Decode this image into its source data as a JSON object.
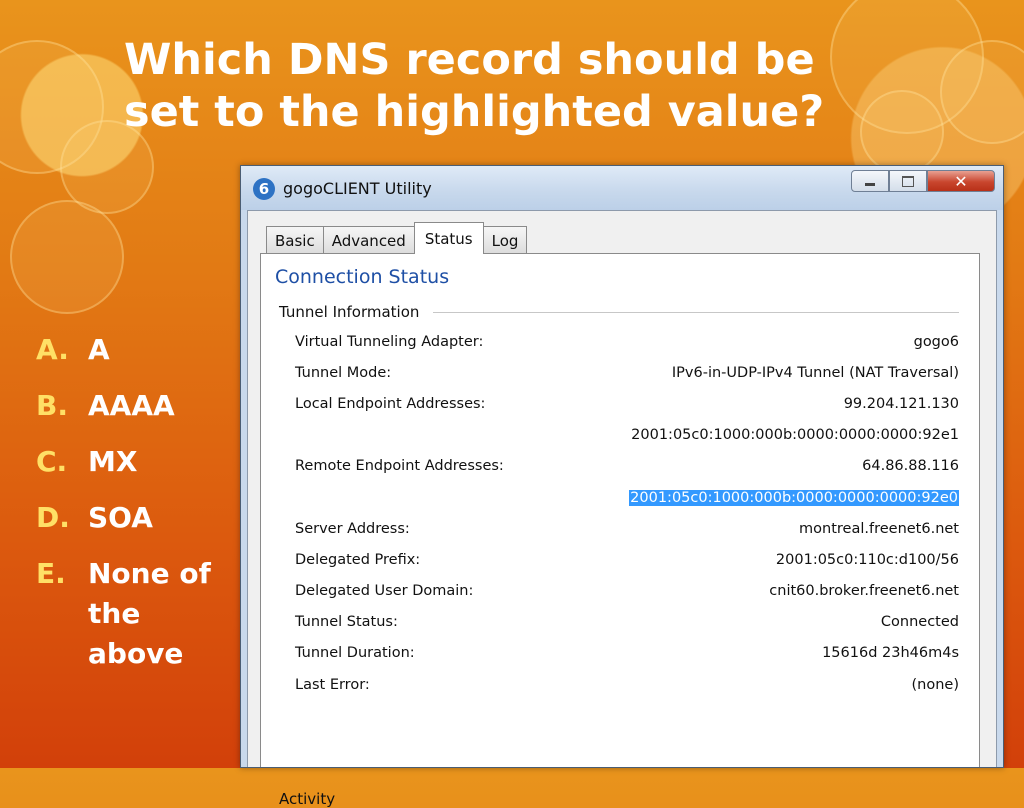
{
  "slide": {
    "title": "Which DNS record should be set to the highlighted value?"
  },
  "answers": [
    {
      "letter": "A.",
      "text": "A"
    },
    {
      "letter": "B.",
      "text": "AAAA"
    },
    {
      "letter": "C.",
      "text": "MX"
    },
    {
      "letter": "D.",
      "text": "SOA"
    },
    {
      "letter": "E.",
      "text": "None of the above"
    }
  ],
  "window": {
    "title": "gogoCLIENT Utility",
    "icon": "gogo6-app-icon",
    "close_glyph": "✕",
    "tabs": [
      {
        "label": "Basic",
        "active": false
      },
      {
        "label": "Advanced",
        "active": false
      },
      {
        "label": "Status",
        "active": true
      },
      {
        "label": "Log",
        "active": false
      }
    ],
    "section_title": "Connection Status",
    "group_title": "Tunnel Information",
    "highlight_color": "#3399ff",
    "rows": [
      {
        "label": "Virtual Tunneling Adapter:",
        "value": "gogo6"
      },
      {
        "label": "Tunnel Mode:",
        "value": "IPv6-in-UDP-IPv4 Tunnel (NAT Traversal)"
      },
      {
        "label": "Local Endpoint Addresses:",
        "value": "99.204.121.130"
      },
      {
        "label": "",
        "value": "2001:05c0:1000:000b:0000:0000:0000:92e1"
      },
      {
        "label": "Remote Endpoint Addresses:",
        "value": "64.86.88.116"
      },
      {
        "label": "",
        "value": "2001:05c0:1000:000b:0000:0000:0000:92e0",
        "highlighted": true
      },
      {
        "label": "Server Address:",
        "value": "montreal.freenet6.net"
      },
      {
        "label": "Delegated Prefix:",
        "value": "2001:05c0:110c:d100/56"
      },
      {
        "label": "Delegated User Domain:",
        "value": "cnit60.broker.freenet6.net"
      },
      {
        "label": "Tunnel Status:",
        "value": "Connected"
      },
      {
        "label": "Tunnel Duration:",
        "value": "15616d 23h46m4s"
      },
      {
        "label": "Last Error:",
        "value": "(none)"
      }
    ],
    "activity_label": "Activity"
  }
}
